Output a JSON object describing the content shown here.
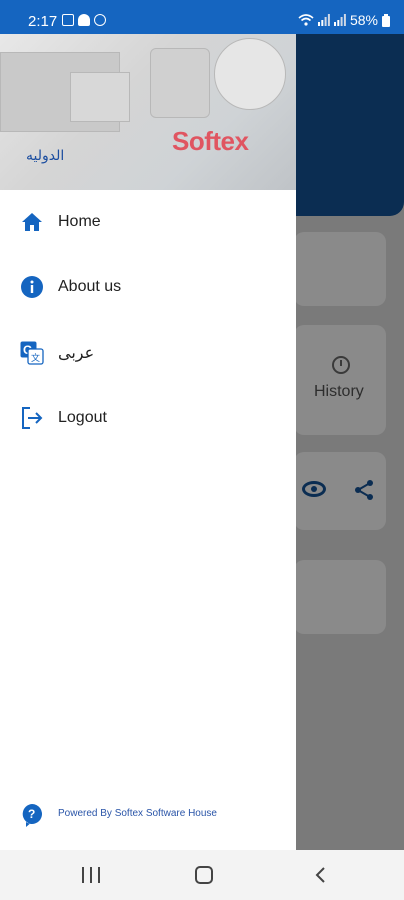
{
  "status_bar": {
    "time": "2:17",
    "battery": "58%",
    "left_icons": [
      "photo-icon",
      "android-icon",
      "whatsapp-icon"
    ],
    "right_icons": [
      "wifi-icon",
      "signal-icon",
      "signal-icon",
      "battery-icon"
    ]
  },
  "drawer": {
    "header": {
      "company_name": "الدوليه",
      "brand_logo": "Softex"
    },
    "items": [
      {
        "label": "Home",
        "icon": "home-icon"
      },
      {
        "label": "About us",
        "icon": "info-icon"
      },
      {
        "label": "عربى",
        "icon": "translate-icon"
      },
      {
        "label": "Logout",
        "icon": "logout-icon"
      }
    ],
    "footer": {
      "label": "Powered By Softex Software House",
      "icon": "help-icon"
    }
  },
  "background": {
    "history_label": "History",
    "icons": [
      "history-icon",
      "eye-icon",
      "share-icon"
    ]
  },
  "colors": {
    "primary": "#1565c0",
    "header_dark": "#0b2d52",
    "accent_blue": "#1c4ea0"
  },
  "nav_bar": {
    "buttons": [
      "recents-button",
      "home-button",
      "back-button"
    ]
  }
}
